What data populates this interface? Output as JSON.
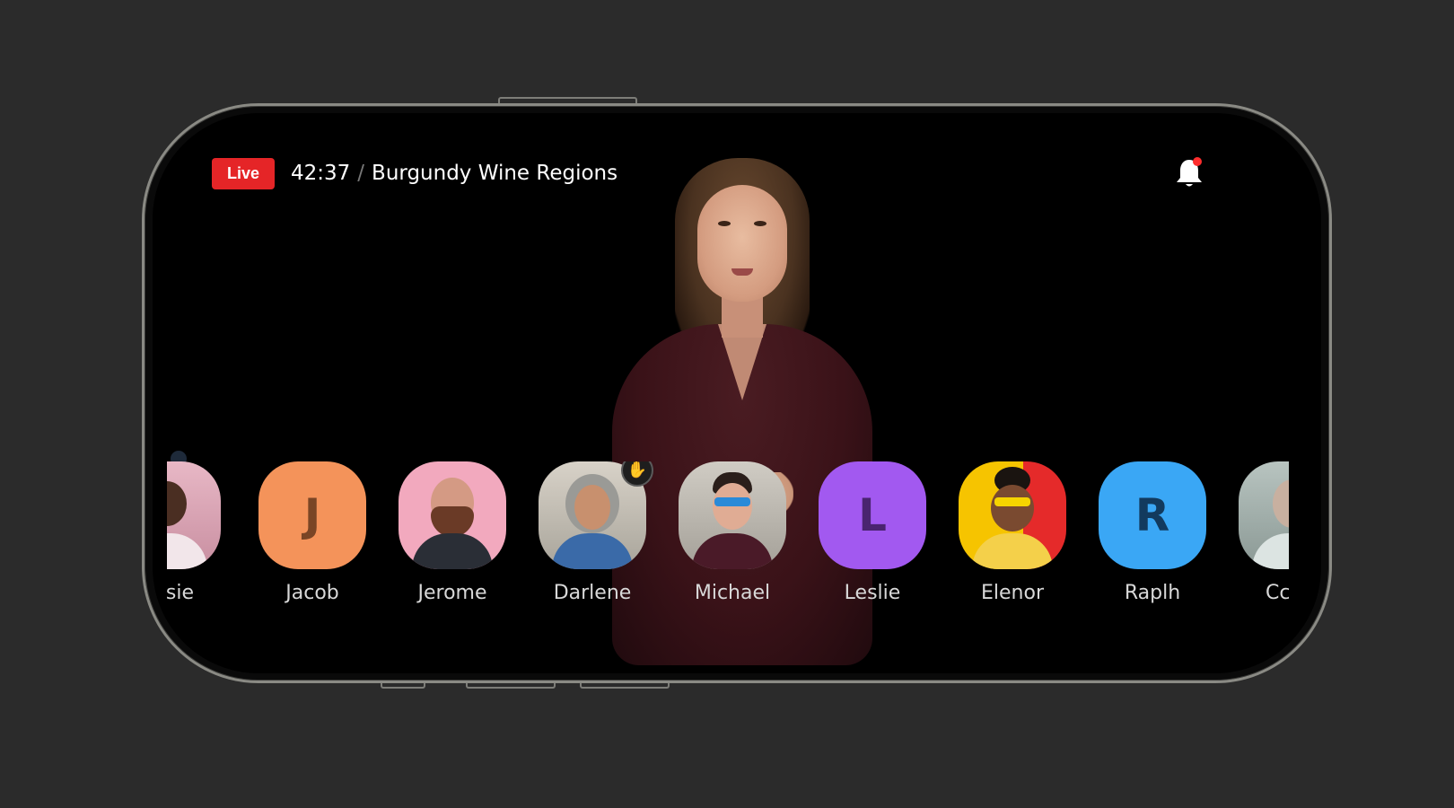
{
  "stream": {
    "live_label": "Live",
    "elapsed": "42:37",
    "separator": "/",
    "title": "Burgundy Wine Regions"
  },
  "colors": {
    "live_red": "#e52527",
    "notification_dot": "#ff2d2d",
    "jacob_avatar": "#f4935a",
    "leslie_avatar": "#a259f0",
    "raplh_avatar": "#3aa7f5"
  },
  "icons": {
    "notifications": "bell-icon",
    "raise_hand": "raised-hand-icon"
  },
  "participants": [
    {
      "name": "ssie",
      "type": "photo",
      "raised_hand": false
    },
    {
      "name": "Jacob",
      "type": "initial",
      "initial": "J",
      "raised_hand": false
    },
    {
      "name": "Jerome",
      "type": "photo",
      "raised_hand": false
    },
    {
      "name": "Darlene",
      "type": "photo",
      "raised_hand": true
    },
    {
      "name": "Michael",
      "type": "photo",
      "raised_hand": false
    },
    {
      "name": "Leslie",
      "type": "initial",
      "initial": "L",
      "raised_hand": false
    },
    {
      "name": "Elenor",
      "type": "photo",
      "raised_hand": false
    },
    {
      "name": "Raplh",
      "type": "initial",
      "initial": "R",
      "raised_hand": false
    },
    {
      "name": "Cc",
      "type": "photo",
      "raised_hand": false
    }
  ]
}
